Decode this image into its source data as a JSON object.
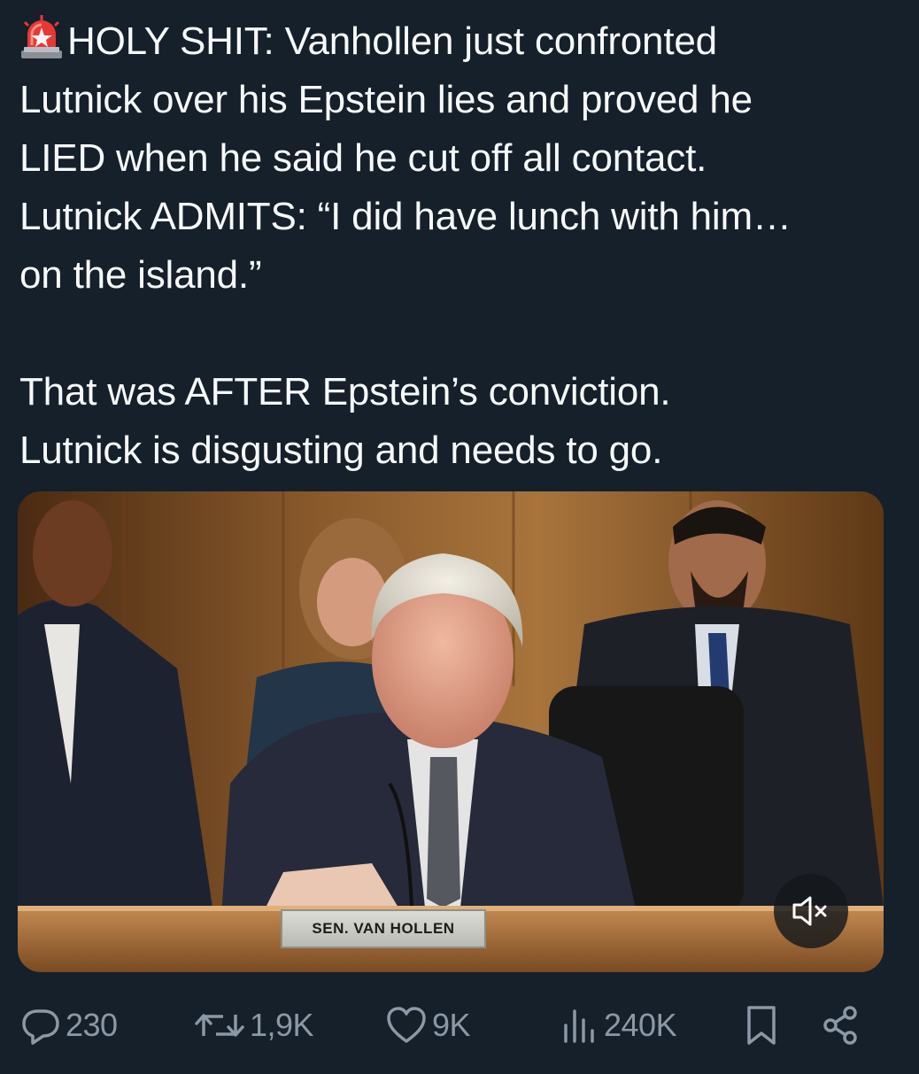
{
  "tweet": {
    "line1": "HOLY SHIT: Vanhollen just confronted",
    "line2": "Lutnick over his Epstein lies and proved he",
    "line3": "LIED when he said he cut off all contact.",
    "line4": "Lutnick ADMITS: “I did have lunch with him…",
    "line5": "on the island.”",
    "line6": "That was AFTER Epstein’s conviction.",
    "line7": "Lutnick is disgusting and needs to go.",
    "leading_icon": "siren-emoji-icon"
  },
  "media": {
    "nameplate": "SEN. VAN HOLLEN",
    "mute_icon": "speaker-muted-icon"
  },
  "actions": {
    "replies": "230",
    "reposts": "1,9K",
    "likes": "9K",
    "views": "240K",
    "bookmark_icon": "bookmark-icon",
    "share_icon": "share-icon"
  },
  "colors": {
    "background": "#15202b",
    "text": "#f7f9f9",
    "secondary": "#8b98a5"
  }
}
